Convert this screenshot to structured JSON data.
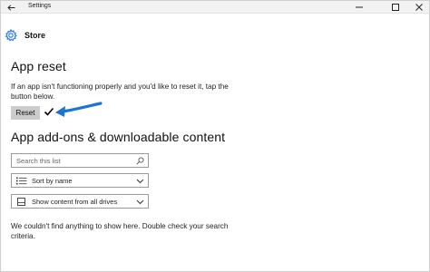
{
  "window": {
    "title": "Settings"
  },
  "header": {
    "title": "Store",
    "icon": "gear-icon"
  },
  "app_reset": {
    "heading": "App reset",
    "description": "If an app isn't functioning properly and you'd like to reset it, tap the button below.",
    "button_label": "Reset"
  },
  "addons": {
    "heading": "App add-ons & downloadable content",
    "search_placeholder": "Search this list",
    "sort_value": "Sort by name",
    "filter_value": "Show content from all drives",
    "empty_message": "We couldn't find anything to show here. Double check your search criteria."
  },
  "colors": {
    "accent": "#1e73d6",
    "button_bg": "#cccccc"
  }
}
